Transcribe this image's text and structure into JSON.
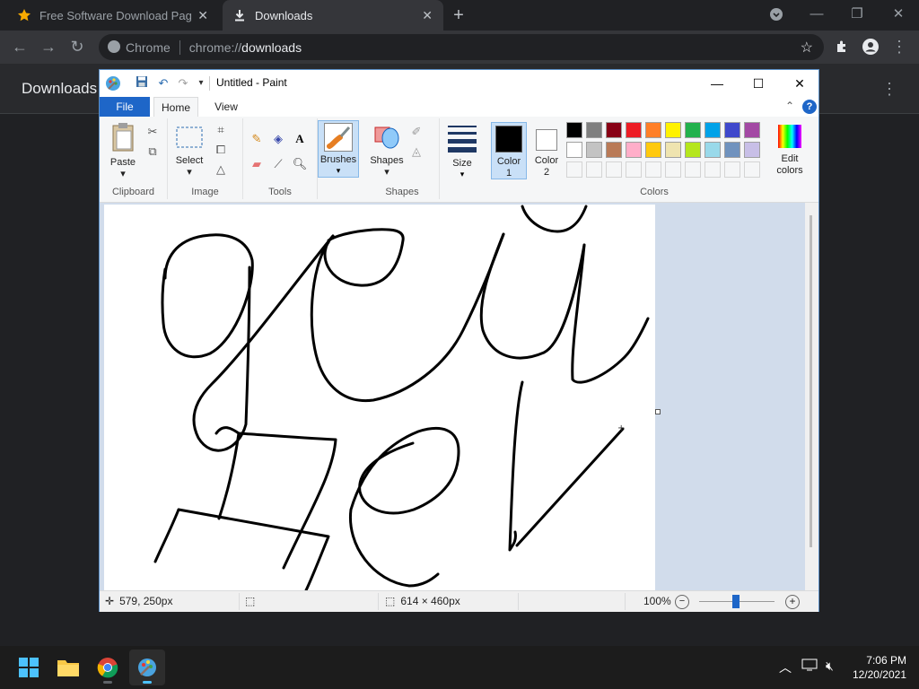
{
  "browser": {
    "tabs": [
      {
        "title": "Free Software Download Page - S",
        "icon": "star-icon",
        "active": false
      },
      {
        "title": "Downloads",
        "icon": "download-icon",
        "active": true
      }
    ],
    "address": {
      "chip": "Chrome",
      "scheme": "chrome://",
      "host": "downloads"
    },
    "page_title": "Downloads"
  },
  "paint": {
    "title": "Untitled - Paint",
    "tabs": {
      "file": "File",
      "home": "Home",
      "view": "View"
    },
    "groups": {
      "clipboard": {
        "label": "Clipboard",
        "paste": "Paste"
      },
      "image": {
        "label": "Image",
        "select": "Select"
      },
      "tools": {
        "label": "Tools"
      },
      "brushes": {
        "label": "Brushes"
      },
      "shapes": {
        "label": "Shapes",
        "shapes_btn": "Shapes"
      },
      "size": {
        "label": "Size"
      },
      "colors": {
        "label": "Colors",
        "color1": "Color",
        "color1_num": "1",
        "color2": "Color",
        "color2_num": "2",
        "edit_line1": "Edit",
        "edit_line2": "colors"
      }
    },
    "palette_row1": [
      "#000000",
      "#7f7f7f",
      "#880015",
      "#ed1c24",
      "#ff7f27",
      "#fff200",
      "#22b14c",
      "#00a2e8",
      "#3f48cc",
      "#a349a4"
    ],
    "palette_row2": [
      "#ffffff",
      "#c3c3c3",
      "#b97a57",
      "#ffaec9",
      "#ffc90e",
      "#efe4b0",
      "#b5e61d",
      "#99d9ea",
      "#7092be",
      "#c8bfe7"
    ],
    "color1_value": "#000000",
    "color2_value": "#ffffff",
    "status": {
      "cursor_pos": "579, 250px",
      "canvas_size": "614 × 460px",
      "zoom": "100%"
    }
  },
  "taskbar": {
    "time": "7:06 PM",
    "date": "12/20/2021"
  }
}
